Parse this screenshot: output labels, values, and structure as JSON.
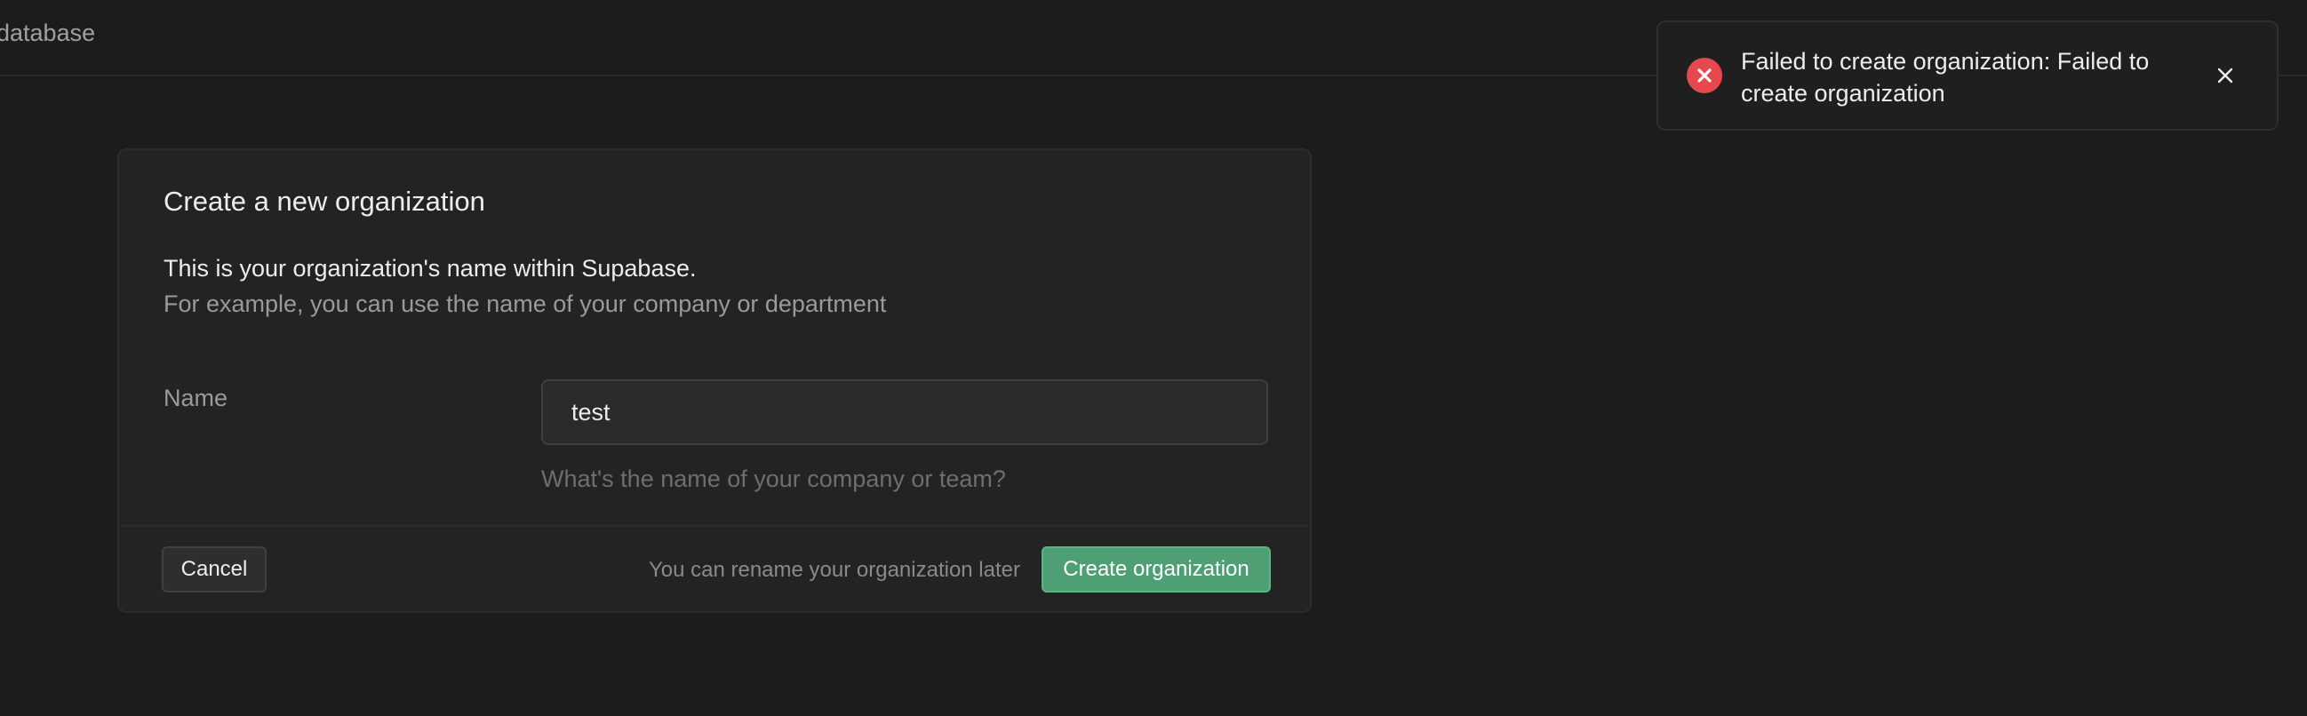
{
  "header": {
    "title": "database"
  },
  "form": {
    "title": "Create a new organization",
    "description": "This is your organization's name within Supabase.",
    "description_sub": "For example, you can use the name of your company or department",
    "name_label": "Name",
    "name_value": "test",
    "name_help": "What's the name of your company or team?",
    "cancel_label": "Cancel",
    "rename_note": "You can rename your organization later",
    "create_label": "Create organization"
  },
  "toast": {
    "message": "Failed to create organization: Failed to create organization",
    "icon": "error-circle-icon",
    "close_icon": "close-icon"
  },
  "colors": {
    "background": "#1c1c1c",
    "card": "#232323",
    "accent": "#4f9f74",
    "error": "#e5484d"
  }
}
